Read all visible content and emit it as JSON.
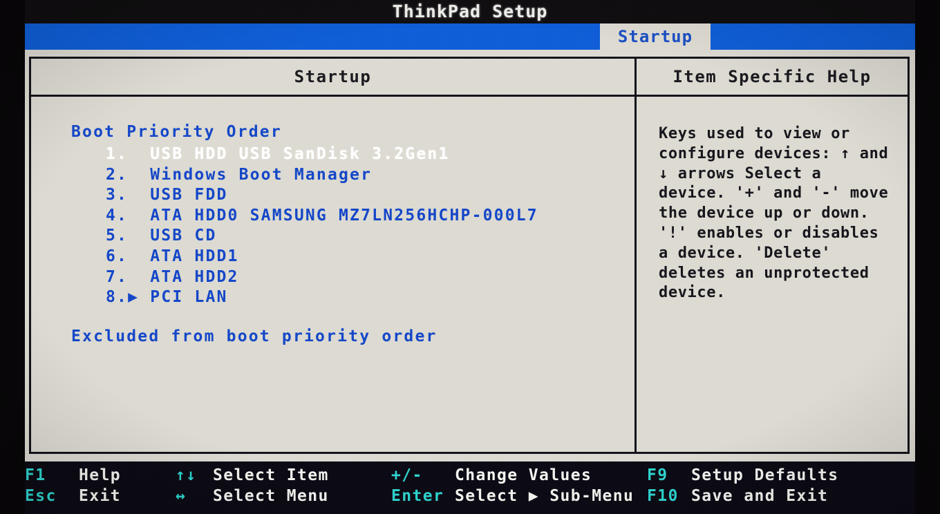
{
  "window": {
    "title": "ThinkPad Setup"
  },
  "tabs": [
    {
      "label": "Startup",
      "active": true
    }
  ],
  "panels": {
    "settings_header": "Startup",
    "help_header": "Item Specific Help"
  },
  "boot_priority": {
    "group_title": "Boot Priority Order",
    "items": [
      {
        "index": "1.",
        "arrow": "",
        "label": "USB HDD USB SanDisk 3.2Gen1",
        "selected": true
      },
      {
        "index": "2.",
        "arrow": "",
        "label": "Windows Boot Manager",
        "selected": false
      },
      {
        "index": "3.",
        "arrow": "",
        "label": "USB FDD",
        "selected": false
      },
      {
        "index": "4.",
        "arrow": "",
        "label": "ATA HDD0 SAMSUNG MZ7LN256HCHP-000L7",
        "selected": false
      },
      {
        "index": "5.",
        "arrow": "",
        "label": "USB CD",
        "selected": false
      },
      {
        "index": "6.",
        "arrow": "",
        "label": "ATA HDD1",
        "selected": false
      },
      {
        "index": "7.",
        "arrow": "",
        "label": "ATA HDD2",
        "selected": false
      },
      {
        "index": "8.",
        "arrow": "▶",
        "label": "PCI LAN",
        "selected": false
      }
    ]
  },
  "excluded": {
    "title": "Excluded from boot priority order",
    "items": []
  },
  "help": {
    "text": "Keys used to view or configure devices: ↑ and ↓ arrows Select a device. '+' and '-' move the device up or down. '!' enables or disables a device. 'Delete' deletes an unprotected device."
  },
  "legend": {
    "rows": [
      [
        {
          "key": "F1",
          "desc": "Help"
        },
        {
          "key": "↑↓",
          "desc": "Select Item"
        },
        {
          "key": "+/-",
          "desc": "Change Values"
        },
        {
          "key": "F9",
          "desc": "Setup Defaults"
        }
      ],
      [
        {
          "key": "Esc",
          "desc": "Exit"
        },
        {
          "key": "↔",
          "desc": "Select Menu"
        },
        {
          "key": "Enter",
          "desc": "Select ▶ Sub-Menu"
        },
        {
          "key": "F10",
          "desc": "Save and Exit"
        }
      ]
    ]
  },
  "colors": {
    "accent_blue": "#1446c8",
    "tabbar_blue": "#0f5ed8",
    "panel_bg": "#dcdad1",
    "legend_key": "#2fd4cf",
    "legend_desc": "#f4f4f0",
    "selected_text": "#ffffff"
  }
}
